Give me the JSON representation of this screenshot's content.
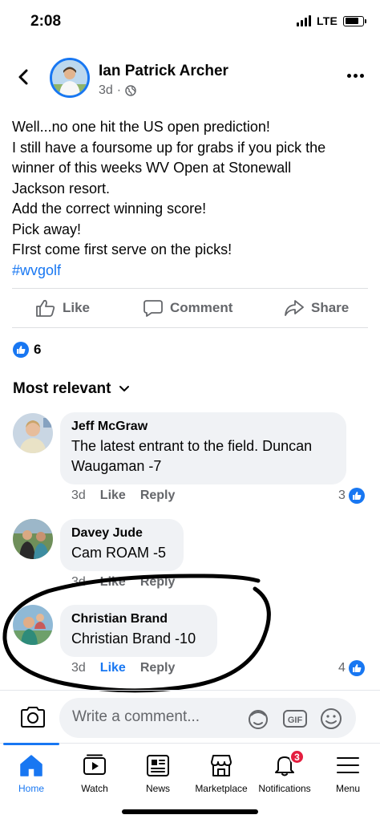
{
  "status_bar": {
    "time": "2:08",
    "network": "LTE"
  },
  "post": {
    "author": "Ian Patrick Archer",
    "time": "3d",
    "privacy_icon": "globe-icon",
    "lines": [
      "Well...no one hit the US open prediction!",
      "I still have a foursome up for grabs if you pick the",
      "winner of this weeks WV Open at Stonewall",
      "Jackson resort.",
      "Add the correct winning score!",
      "Pick away!",
      "FIrst come first serve on the picks!"
    ],
    "hashtag": "#wvgolf"
  },
  "actions": {
    "like": "Like",
    "comment": "Comment",
    "share": "Share"
  },
  "reactions": {
    "count": "6"
  },
  "sort_label": "Most relevant",
  "comments": [
    {
      "name": "Jeff McGraw",
      "text_lines": [
        "The latest entrant to the field. Duncan",
        "Waugaman -7"
      ],
      "time": "3d",
      "like": "Like",
      "reply": "Reply",
      "reaction_count": "3",
      "liked": false
    },
    {
      "name": "Davey Jude",
      "text_lines": [
        "Cam ROAM -5"
      ],
      "time": "3d",
      "like": "Like",
      "reply": "Reply",
      "reaction_count": "",
      "liked": false
    },
    {
      "name": "Christian Brand",
      "text_lines": [
        "Christian Brand -10"
      ],
      "time": "3d",
      "like": "Like",
      "reply": "Reply",
      "reaction_count": "4",
      "liked": true
    }
  ],
  "composer": {
    "placeholder": "Write a comment...",
    "gif_label": "GIF"
  },
  "tabs": [
    {
      "label": "Home",
      "icon": "home-icon",
      "active": true
    },
    {
      "label": "Watch",
      "icon": "watch-icon"
    },
    {
      "label": "News",
      "icon": "news-icon"
    },
    {
      "label": "Marketplace",
      "icon": "marketplace-icon"
    },
    {
      "label": "Notifications",
      "icon": "bell-icon",
      "badge": "3"
    },
    {
      "label": "Menu",
      "icon": "menu-icon"
    }
  ],
  "colors": {
    "accent": "#1877f2",
    "secondary_text": "#65676b",
    "bubble": "#f0f2f5",
    "badge": "#e41e3f"
  }
}
